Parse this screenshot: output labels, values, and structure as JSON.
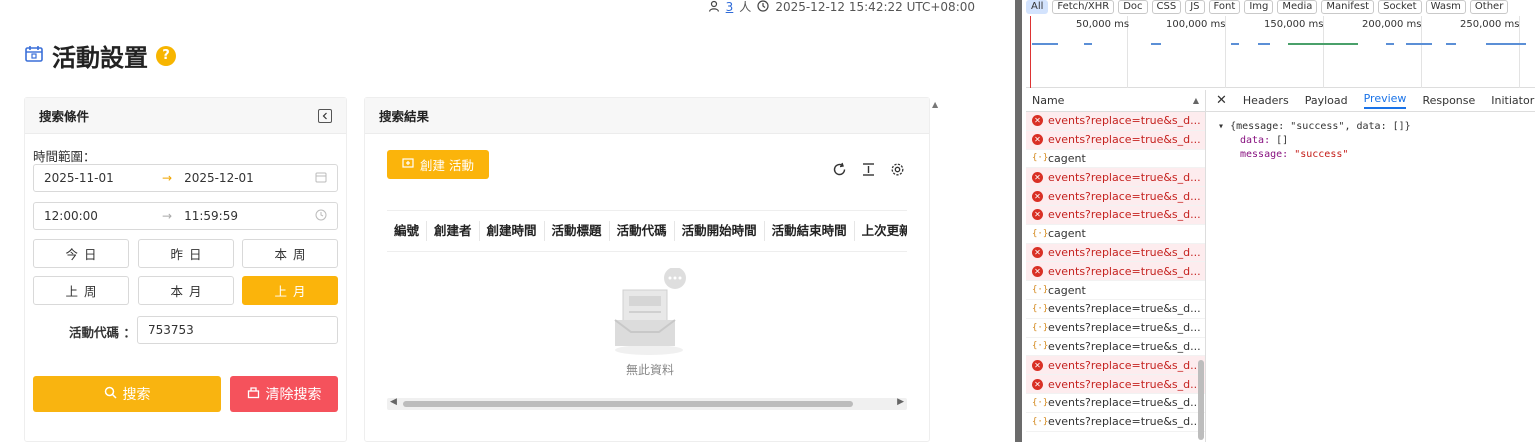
{
  "topbar": {
    "user_icon": "user-icon",
    "user_count": "3",
    "user_unit": "人",
    "clock_icon": "clock-icon",
    "datetime": "2025-12-12 15:42:22 UTC+08:00"
  },
  "page": {
    "title": "活動設置",
    "calendar_icon": "calendar-icon",
    "help": "?"
  },
  "search_panel": {
    "title": "搜索條件",
    "time_range_label": "時間範圍：",
    "date_start": "2025-11-01",
    "date_end": "2025-12-01",
    "time_start": "12:00:00",
    "time_end": "11:59:59",
    "arrow": "→",
    "quick": [
      "今日",
      "昨日",
      "本周",
      "上周",
      "本月",
      "上月"
    ],
    "active_quick": "上月",
    "code_label": "活動代碼 ：",
    "code_value": "753753",
    "search_btn": "搜索",
    "clear_btn": "清除搜索"
  },
  "result_panel": {
    "title": "搜索結果",
    "create_btn": "創建 活動",
    "columns": [
      "編號",
      "創建者",
      "創建時間",
      "活動標題",
      "活動代碼",
      "活動開始時間",
      "活動結束時間",
      "上次更新"
    ],
    "empty_text": "無此資料"
  },
  "devtools": {
    "filters": [
      "All",
      "Fetch/XHR",
      "Doc",
      "CSS",
      "JS",
      "Font",
      "Img",
      "Media",
      "Manifest",
      "Socket",
      "Wasm",
      "Other"
    ],
    "active_filter": "All",
    "ticks": [
      "50,000 ms",
      "100,000 ms",
      "150,000 ms",
      "200,000 ms",
      "250,000 ms"
    ],
    "name_header": "Name",
    "requests": [
      {
        "name": "events?replace=true&s_d...",
        "status": "error"
      },
      {
        "name": "events?replace=true&s_d...",
        "status": "error"
      },
      {
        "name": "cagent",
        "status": "ok"
      },
      {
        "name": "events?replace=true&s_d...",
        "status": "error"
      },
      {
        "name": "events?replace=true&s_d...",
        "status": "error"
      },
      {
        "name": "events?replace=true&s_d...",
        "status": "error"
      },
      {
        "name": "cagent",
        "status": "ok"
      },
      {
        "name": "events?replace=true&s_d...",
        "status": "error"
      },
      {
        "name": "events?replace=true&s_d...",
        "status": "error"
      },
      {
        "name": "cagent",
        "status": "ok"
      },
      {
        "name": "events?replace=true&s_d...",
        "status": "ok"
      },
      {
        "name": "events?replace=true&s_d...",
        "status": "ok"
      },
      {
        "name": "events?replace=true&s_d...",
        "status": "ok"
      },
      {
        "name": "events?replace=true&s_d...",
        "status": "error"
      },
      {
        "name": "events?replace=true&s_d...",
        "status": "error"
      },
      {
        "name": "events?replace=true&s_d...",
        "status": "ok"
      },
      {
        "name": "events?replace=true&s_d...",
        "status": "ok"
      }
    ],
    "detail_tabs": [
      "Headers",
      "Payload",
      "Preview",
      "Response",
      "Initiator"
    ],
    "active_tab": "Preview",
    "json_summary": "{message: \"success\", data: []}",
    "json_data_key": "data:",
    "json_data_val": "[]",
    "json_msg_key": "message:",
    "json_msg_val": "\"success\""
  },
  "colors": {
    "accent": "#fbb40b",
    "danger": "#f5525c",
    "link": "#2f6bd8"
  }
}
